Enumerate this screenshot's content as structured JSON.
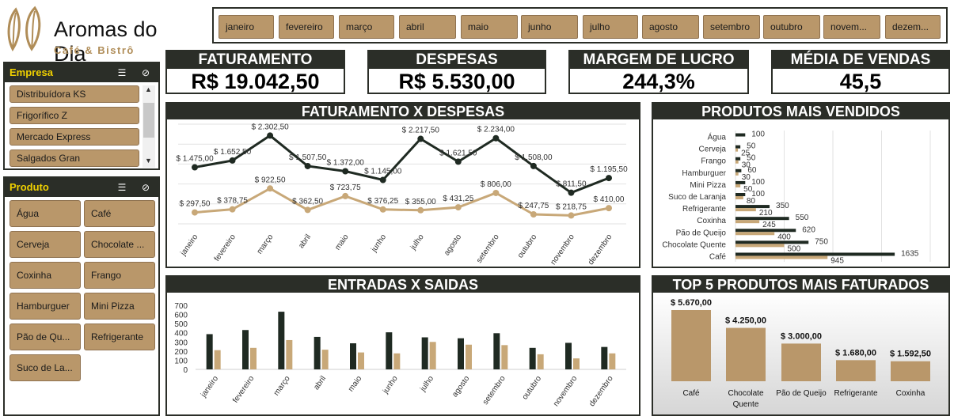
{
  "brand": {
    "name": "Aromas do Dia",
    "tagline": "Café & Bistrô"
  },
  "months": [
    "janeiro",
    "fevereiro",
    "março",
    "abril",
    "maio",
    "junho",
    "julho",
    "agosto",
    "setembro",
    "outubro",
    "novem...",
    "dezem..."
  ],
  "empresa_slicer": {
    "title": "Empresa",
    "items": [
      "Distribuídora KS",
      "Frigorífico Z",
      "Mercado Express",
      "Salgados Gran"
    ]
  },
  "produto_slicer": {
    "title": "Produto",
    "items": [
      "Água",
      "Café",
      "Cerveja",
      "Chocolate ...",
      "Coxinha",
      "Frango",
      "Hamburguer",
      "Mini Pizza",
      "Pão de Qu...",
      "Refrigerante",
      "Suco de La..."
    ]
  },
  "kpis": [
    {
      "label": "FATURAMENTO",
      "value": "R$ 19.042,50"
    },
    {
      "label": "DESPESAS",
      "value": "R$ 5.530,00"
    },
    {
      "label": "MARGEM DE LUCRO",
      "value": "244,3%"
    },
    {
      "label": "MÉDIA DE VENDAS",
      "value": "45,5"
    }
  ],
  "panels": {
    "fat_desp": "FATURAMENTO X DESPESAS",
    "produtos": "PRODUTOS MAIS VENDIDOS",
    "entradas": "ENTRADAS X SAIDAS",
    "top5": "TOP 5 PRODUTOS MAIS FATURADOS"
  },
  "colors": {
    "dark": "#2b2e28",
    "tan": "#b9976a",
    "series_dark": "#1f2a22",
    "series_tan": "#c8a878"
  },
  "chart_data": [
    {
      "type": "line",
      "title": "FATURAMENTO X DESPESAS",
      "categories": [
        "janeiro",
        "fevereiro",
        "março",
        "abril",
        "maio",
        "junho",
        "julho",
        "agosto",
        "setembro",
        "outubro",
        "novembro",
        "dezembro"
      ],
      "series": [
        {
          "values": [
            1475.0,
            1652.5,
            2302.5,
            1507.5,
            1372.0,
            1145.0,
            2217.5,
            1621.5,
            2234.0,
            1508.0,
            811.5,
            1195.5
          ],
          "labels": [
            "$ 1.475,00",
            "$ 1.652,50",
            "$ 2.302,50",
            "$ 1.507,50",
            "$ 1.372,00",
            "$ 1.145,00",
            "$ 2.217,50",
            "$ 1.621,50",
            "$ 2.234,00",
            "$ 1.508,00",
            "$ 811,50",
            "$ 1.195,50"
          ]
        },
        {
          "values": [
            297.5,
            378.75,
            922.5,
            362.5,
            723.75,
            376.25,
            355.0,
            431.25,
            806.0,
            247.75,
            218.75,
            410.0
          ],
          "labels": [
            "$ 297,50",
            "$ 378,75",
            "$ 922,50",
            "$ 362,50",
            "$ 723,75",
            "$ 376,25",
            "$ 355,00",
            "$ 431,25",
            "$ 806,00",
            "$ 247,75",
            "$ 218,75",
            "$ 410,00"
          ]
        }
      ],
      "grid": true
    },
    {
      "type": "bar",
      "title": "PRODUTOS MAIS VENDIDOS",
      "orientation": "horizontal",
      "categories": [
        "Água",
        "Cerveja",
        "Frango",
        "Hamburguer",
        "Mini Pizza",
        "Suco de Laranja",
        "Refrigerante",
        "Coxinha",
        "Pão de Queijo",
        "Chocolate Quente",
        "Café"
      ],
      "series": [
        {
          "values": [
            100,
            50,
            50,
            60,
            100,
            100,
            350,
            550,
            620,
            750,
            1635
          ]
        },
        {
          "values": [
            0,
            25,
            30,
            30,
            50,
            80,
            210,
            245,
            400,
            500,
            945
          ]
        }
      ],
      "xlim": [
        0,
        2000
      ],
      "grid": true
    },
    {
      "type": "bar",
      "title": "ENTRADAS X SAIDAS",
      "categories": [
        "janeiro",
        "fevereiro",
        "março",
        "abril",
        "maio",
        "junho",
        "julho",
        "agosto",
        "setembro",
        "outubro",
        "novembro",
        "dezembro"
      ],
      "series": [
        {
          "values": [
            385,
            430,
            630,
            355,
            285,
            405,
            350,
            340,
            395,
            235,
            290,
            245
          ]
        },
        {
          "values": [
            210,
            235,
            320,
            215,
            185,
            175,
            300,
            270,
            265,
            165,
            120,
            175
          ]
        }
      ],
      "yticks": [
        "700",
        "600",
        "500",
        "400",
        "300",
        "200",
        "100",
        "0"
      ],
      "ylim": [
        0,
        700
      ]
    },
    {
      "type": "bar",
      "title": "TOP 5 PRODUTOS MAIS FATURADOS",
      "categories": [
        "Café",
        "Chocolate Quente",
        "Pão de Queijo",
        "Refrigerante",
        "Coxinha"
      ],
      "values": [
        5670.0,
        4250.0,
        3000.0,
        1680.0,
        1592.5
      ],
      "labels": [
        "$ 5.670,00",
        "$ 4.250,00",
        "$ 3.000,00",
        "$ 1.680,00",
        "$ 1.592,50"
      ]
    }
  ]
}
